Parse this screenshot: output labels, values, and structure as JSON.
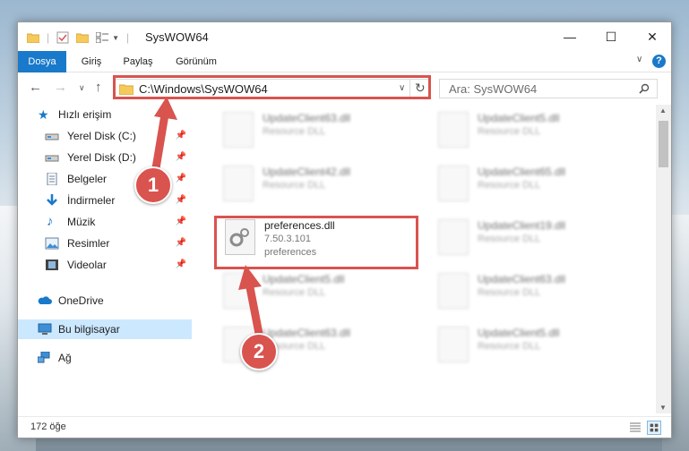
{
  "window": {
    "title": "SysWOW64",
    "minimize_glyph": "—",
    "maximize_glyph": "☐",
    "close_glyph": "✕"
  },
  "ribbon": {
    "tabs": [
      "Dosya",
      "Giriş",
      "Paylaş",
      "Görünüm"
    ],
    "chevron": "∨",
    "help": "?"
  },
  "address": {
    "path": "C:\\Windows\\SysWOW64",
    "search_placeholder": "Ara: SysWOW64",
    "refresh_glyph": "↻",
    "dropdown_glyph": "∨"
  },
  "sidebar": {
    "items": [
      {
        "label": "Hızlı erişim",
        "icon": "star-icon",
        "pinned": false
      },
      {
        "label": "Yerel Disk (C:)",
        "icon": "drive-icon",
        "pinned": true
      },
      {
        "label": "Yerel Disk (D:)",
        "icon": "drive-icon",
        "pinned": true
      },
      {
        "label": "Belgeler",
        "icon": "document-icon",
        "pinned": true
      },
      {
        "label": "İndirmeler",
        "icon": "download-icon",
        "pinned": true
      },
      {
        "label": "Müzik",
        "icon": "music-icon",
        "pinned": true
      },
      {
        "label": "Resimler",
        "icon": "pictures-icon",
        "pinned": true
      },
      {
        "label": "Videolar",
        "icon": "video-icon",
        "pinned": true
      },
      {
        "label": "OneDrive",
        "icon": "cloud-icon",
        "pinned": false
      },
      {
        "label": "Bu bilgisayar",
        "icon": "computer-icon",
        "pinned": false,
        "selected": true
      },
      {
        "label": "Ağ",
        "icon": "network-icon",
        "pinned": false
      }
    ],
    "pin_glyph": "📌"
  },
  "files": [
    {
      "name": "UpdateClient63.dll",
      "sub": "Resource DLL"
    },
    {
      "name": "UpdateClient5.dll",
      "sub": "Resource DLL"
    },
    {
      "name": "UpdateClient42.dll",
      "sub": "Resource DLL"
    },
    {
      "name": "UpdateClient65.dll",
      "sub": "Resource DLL"
    },
    {
      "name": "preferences.dll",
      "sub": "7.50.3.101",
      "sub2": "preferences",
      "highlighted": true
    },
    {
      "name": "UpdateClient19.dll",
      "sub": "Resource DLL"
    },
    {
      "name": "UpdateClient5.dll",
      "sub": "Resource DLL"
    },
    {
      "name": "UpdateClient63.dll",
      "sub": "Resource DLL"
    },
    {
      "name": "UpdateClient63.dll",
      "sub": "Resource DLL"
    },
    {
      "name": "UpdateClient5.dll",
      "sub": "Resource DLL"
    }
  ],
  "annotations": {
    "step1": "1",
    "step2": "2",
    "color": "#d9534f"
  },
  "status": {
    "count": "172 öğe"
  }
}
